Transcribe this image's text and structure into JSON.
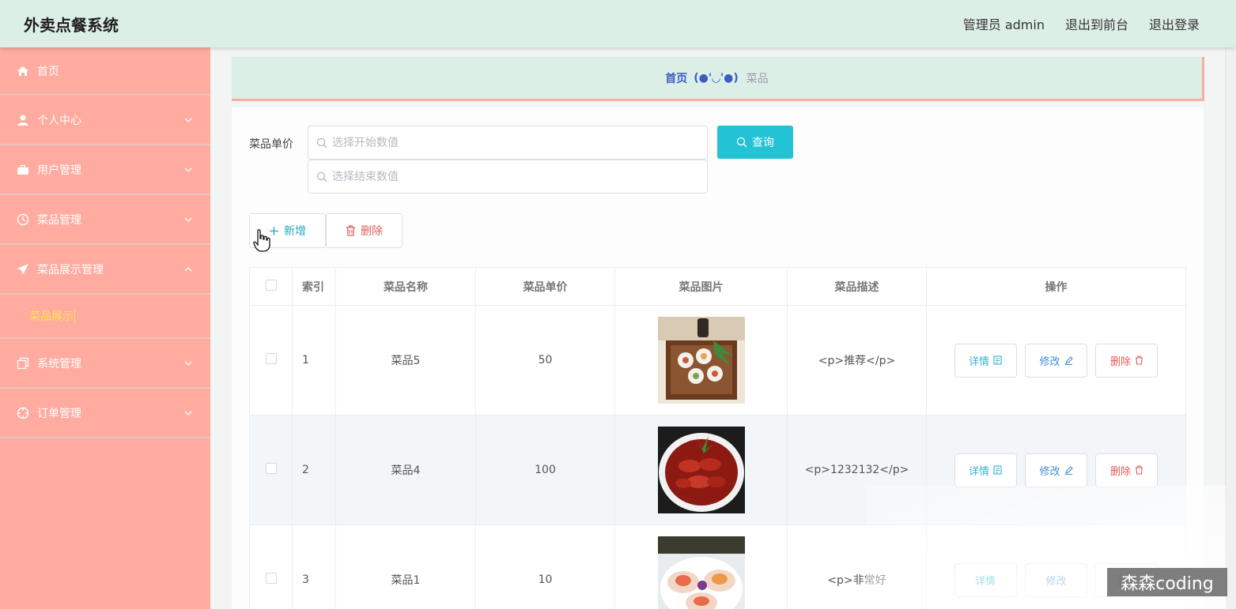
{
  "header": {
    "app_title": "外卖点餐系统",
    "admin_label": "管理员 admin",
    "back_to_front": "退出到前台",
    "logout": "退出登录"
  },
  "sidebar": {
    "items": [
      {
        "label": "首页",
        "icon": "home-icon"
      },
      {
        "label": "个人中心",
        "icon": "user-icon"
      },
      {
        "label": "用户管理",
        "icon": "briefcase-icon"
      },
      {
        "label": "菜品管理",
        "icon": "clock-icon"
      },
      {
        "label": "菜品展示管理",
        "icon": "send-icon",
        "expanded": true,
        "children": [
          {
            "label": "菜品展示",
            "active": true
          }
        ]
      },
      {
        "label": "系统管理",
        "icon": "copy-icon"
      },
      {
        "label": "订单管理",
        "icon": "target-icon"
      }
    ]
  },
  "breadcrumb": {
    "home": "首页",
    "separator": "(●'◡'●)",
    "current": "菜品"
  },
  "search": {
    "label": "菜品单价",
    "start_placeholder": "选择开始数值",
    "end_placeholder": "选择结束数值",
    "query_button": "查询"
  },
  "toolbar": {
    "add_label": "新增",
    "delete_label": "删除"
  },
  "table": {
    "columns": [
      "索引",
      "菜品名称",
      "菜品单价",
      "菜品图片",
      "菜品描述",
      "操作"
    ],
    "rows": [
      {
        "index": "1",
        "name": "菜品5",
        "price": "50",
        "image": "sushi-rolls-image",
        "desc": "<p>推荐</p>"
      },
      {
        "index": "2",
        "name": "菜品4",
        "price": "100",
        "image": "crayfish-image",
        "desc": "<p>1232132</p>"
      },
      {
        "index": "3",
        "name": "菜品1",
        "price": "10",
        "image": "scallops-image",
        "desc": "<p>非常好"
      }
    ],
    "actions": {
      "detail": "详情",
      "edit": "修改",
      "delete": "删除"
    }
  },
  "watermark": "森森coding",
  "colors": {
    "header_bg": "#dcefe7",
    "sidebar_bg": "#ffaba0",
    "accent": "#23c2d5",
    "active_submenu": "#ffe34d",
    "danger": "#e05c5c"
  }
}
